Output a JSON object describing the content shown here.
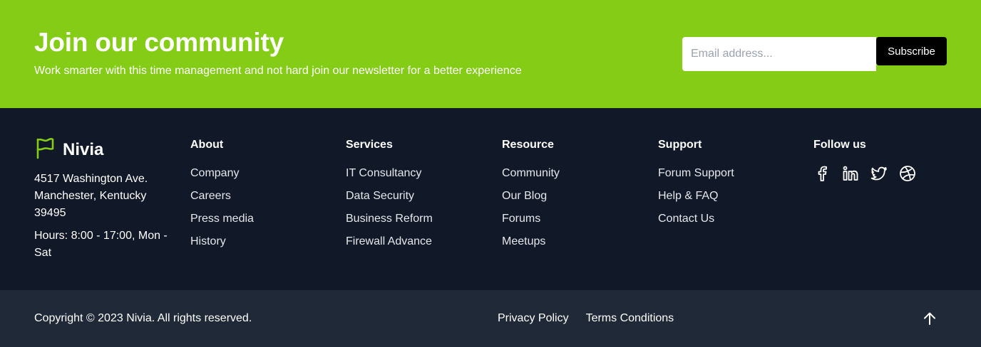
{
  "newsletter": {
    "title": "Join our community",
    "subtitle": "Work smarter with this time management and not hard join our newsletter for a better experience",
    "email_placeholder": "Email address...",
    "subscribe_label": "Subscribe",
    "accent_color": "#84cc16"
  },
  "brand": {
    "name": "Nivia",
    "logo_icon": "flag-icon",
    "address": "4517 Washington Ave. Manchester, Kentucky 39495",
    "hours": "Hours: 8:00 - 17:00, Mon - Sat"
  },
  "columns": [
    {
      "title": "About",
      "items": [
        "Company",
        "Careers",
        "Press media",
        "History"
      ]
    },
    {
      "title": "Services",
      "items": [
        "IT Consultancy",
        "Data Security",
        "Business Reform",
        "Firewall Advance"
      ]
    },
    {
      "title": "Resource",
      "items": [
        "Community",
        "Our Blog",
        "Forums",
        "Meetups"
      ]
    },
    {
      "title": "Support",
      "items": [
        "Forum Support",
        "Help & FAQ",
        "Contact Us"
      ]
    }
  ],
  "follow": {
    "title": "Follow us",
    "icons": [
      "facebook-icon",
      "linkedin-icon",
      "twitter-icon",
      "dribbble-icon"
    ]
  },
  "bottom": {
    "copyright": "Copyright © 2023 Nivia. All rights reserved.",
    "links": [
      "Privacy Policy",
      "Terms Conditions"
    ],
    "back_to_top_icon": "arrow-up-icon"
  }
}
